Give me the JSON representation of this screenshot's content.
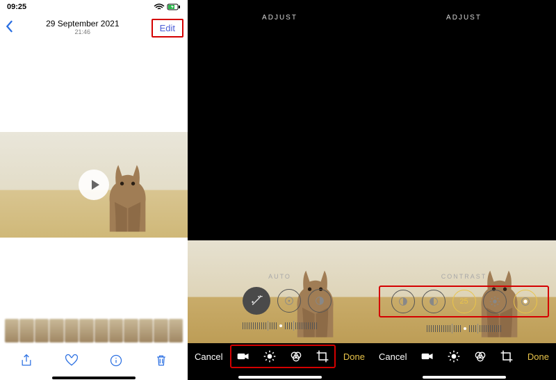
{
  "s1": {
    "status": {
      "time": "09:25"
    },
    "nav": {
      "date": "29 September 2021",
      "time": "21:46",
      "edit": "Edit"
    },
    "toolbar_icons": [
      "share-icon",
      "favorite-icon",
      "info-icon",
      "trash-icon"
    ]
  },
  "s2": {
    "top": "ADJUST",
    "sublabel": "AUTO",
    "bottom": {
      "cancel": "Cancel",
      "done": "Done"
    }
  },
  "s3": {
    "top": "ADJUST",
    "sublabel": "CONTRAST",
    "value": "25",
    "bottom": {
      "cancel": "Cancel",
      "done": "Done"
    }
  },
  "colors": {
    "accent_blue": "#2a6fe2",
    "accent_yellow": "#e9c44a",
    "highlight_red": "#d40000"
  }
}
